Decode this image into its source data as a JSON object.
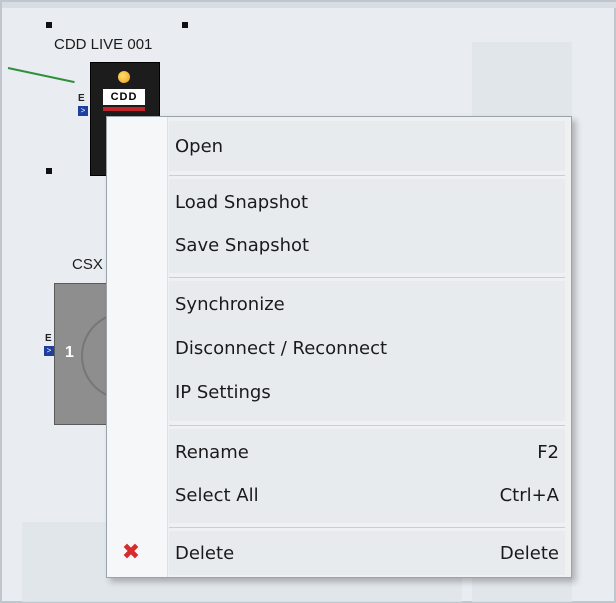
{
  "canvas": {
    "device1": {
      "label": "CDD LIVE 001",
      "logo": "CDD",
      "port_letter": "E",
      "port_flag": ">"
    },
    "device2": {
      "label": "CSX",
      "channel": "1",
      "port_letter": "E",
      "port_flag": ">"
    }
  },
  "context_menu": {
    "items": [
      {
        "label": "Open",
        "shortcut": ""
      },
      {
        "label": "Load Snapshot",
        "shortcut": ""
      },
      {
        "label": "Save Snapshot",
        "shortcut": ""
      },
      {
        "label": "Synchronize",
        "shortcut": ""
      },
      {
        "label": "Disconnect / Reconnect",
        "shortcut": ""
      },
      {
        "label": "IP Settings",
        "shortcut": ""
      },
      {
        "label": "Rename",
        "shortcut": "F2"
      },
      {
        "label": "Select All",
        "shortcut": "Ctrl+A"
      },
      {
        "label": "Delete",
        "shortcut": "Delete",
        "icon": "delete-x-icon"
      }
    ]
  },
  "colors": {
    "wire": "#2f8f3b",
    "delete_icon": "#d62c2c",
    "led": "#f5b02a"
  }
}
